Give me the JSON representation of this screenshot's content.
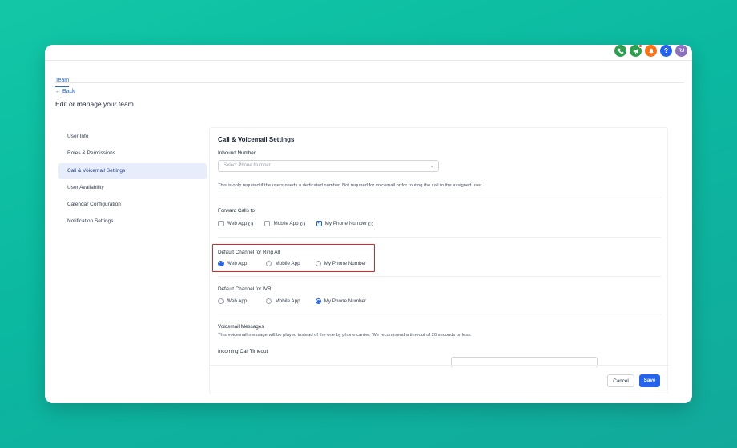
{
  "topbar": {
    "icons": [
      "phone-icon",
      "megaphone-icon",
      "bell-icon",
      "help-icon"
    ],
    "help_glyph": "?",
    "avatar_initials": "RJ"
  },
  "tabs": [
    "Team"
  ],
  "back_label": "← Back",
  "page_title": "Edit or manage your team",
  "sidebar": {
    "items": [
      {
        "label": "User Info"
      },
      {
        "label": "Roles & Permissions"
      },
      {
        "label": "Call & Voicemail Settings"
      },
      {
        "label": "User Availability"
      },
      {
        "label": "Calendar Configuration"
      },
      {
        "label": "Notification Settings"
      }
    ],
    "active_index": 2
  },
  "panel": {
    "title": "Call & Voicemail Settings",
    "inbound": {
      "label": "Inbound Number",
      "placeholder": "Select Phone Number",
      "help": "This is only required if the users needs a dedicated number. Not required for voicemail or for routing the call to the assigned user."
    },
    "forward": {
      "label": "Forward Calls to",
      "options": [
        {
          "label": "Web App",
          "checked": false
        },
        {
          "label": "Mobile App",
          "checked": false
        },
        {
          "label": "My Phone Number",
          "checked": true
        }
      ]
    },
    "ring_all": {
      "label": "Default Channel for Ring All",
      "options": [
        {
          "label": "Web App",
          "selected": true
        },
        {
          "label": "Mobile App",
          "selected": false
        },
        {
          "label": "My Phone Number",
          "selected": false
        }
      ]
    },
    "ivr": {
      "label": "Default Channel for IVR",
      "options": [
        {
          "label": "Web App",
          "selected": false
        },
        {
          "label": "Mobile App",
          "selected": false
        },
        {
          "label": "My Phone Number",
          "selected": true
        }
      ]
    },
    "voicemail": {
      "label": "Voicemail Messages",
      "help": "This voicemail message will be played instead of the one by phone carrier. We recommend a timeout of 20 seconds or less."
    },
    "timeout_label": "Incoming Call Timeout",
    "cancel_label": "Cancel",
    "save_label": "Save"
  },
  "colors": {
    "accent": "#2563eb",
    "highlight": "#dc2626",
    "background": "#12c7a6"
  }
}
